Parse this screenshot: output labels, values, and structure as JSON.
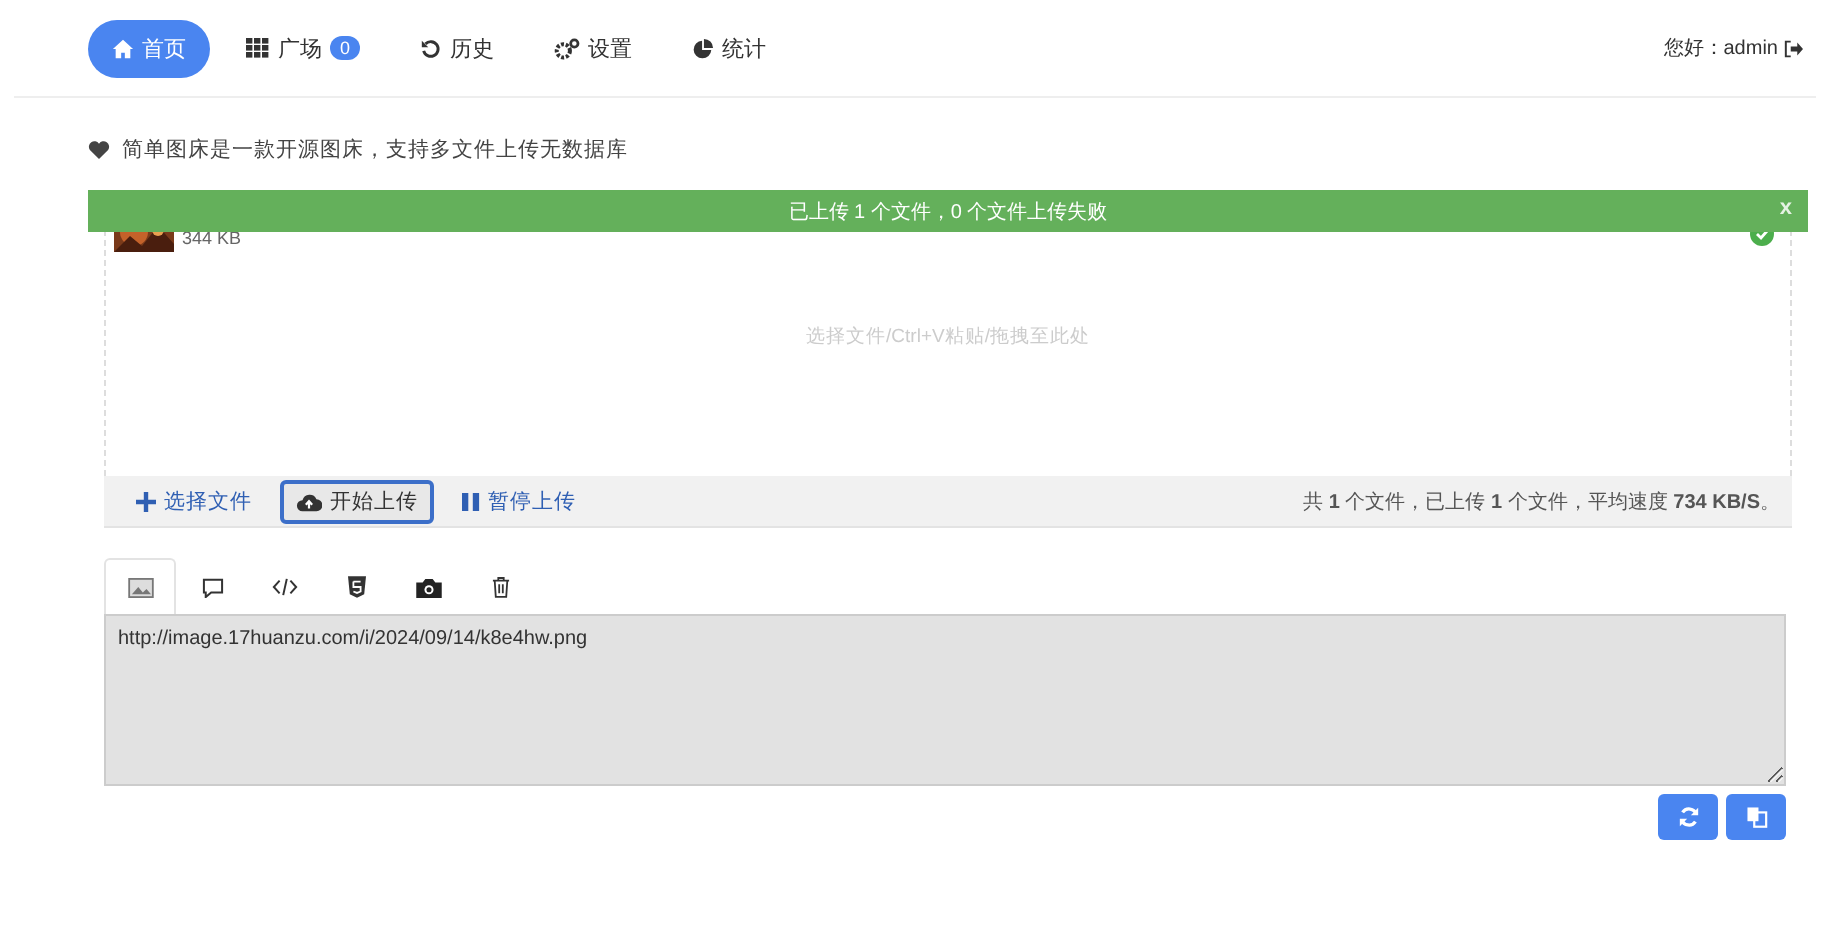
{
  "nav": {
    "items": [
      {
        "label": "首页",
        "selected": true
      },
      {
        "label": "广场",
        "selected": false,
        "badge": "0"
      },
      {
        "label": "历史",
        "selected": false
      },
      {
        "label": "设置",
        "selected": false
      },
      {
        "label": "统计",
        "selected": false
      }
    ],
    "greeting": "您好：admin"
  },
  "intro": "简单图床是一款开源图床，支持多文件上传无数据库",
  "uploader": {
    "alert": "已上传 1 个文件，0 个文件上传失败",
    "alert_close": "x",
    "file": {
      "size": "344 KB",
      "done": true
    },
    "hint": "选择文件/Ctrl+V粘贴/拖拽至此处",
    "buttons": [
      {
        "label": "选择文件",
        "selected": false
      },
      {
        "label": "开始上传",
        "selected": true
      },
      {
        "label": "暂停上传",
        "selected": false
      }
    ],
    "stats": "共 **1** 个文件，已上传 **1** 个文件，平均速度 **734 KB/S**。"
  },
  "output": {
    "tabs": [
      {
        "selected": true
      },
      {
        "selected": false
      },
      {
        "selected": false
      },
      {
        "selected": false
      },
      {
        "selected": false
      },
      {
        "selected": false
      }
    ],
    "value": "http://image.17huanzu.com/i/2024/09/14/k8e4hw.png"
  }
}
